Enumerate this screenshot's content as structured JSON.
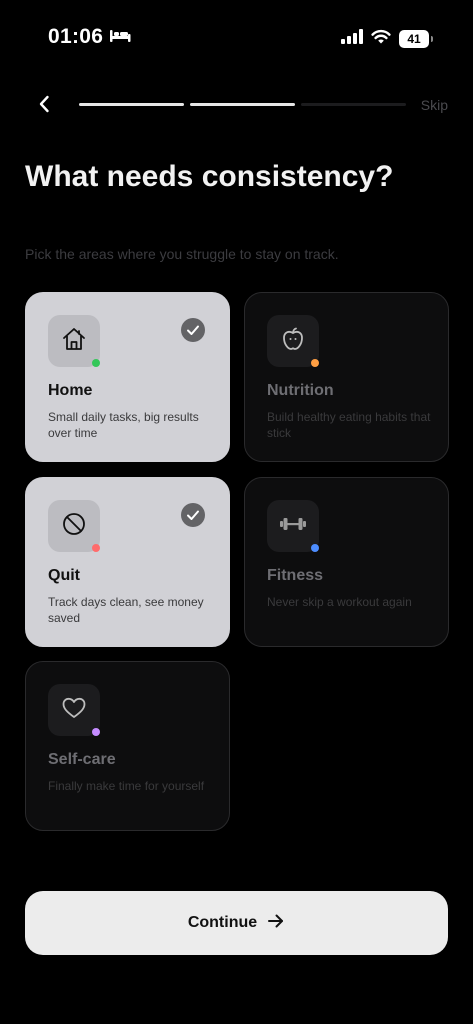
{
  "status_bar": {
    "time": "01:06",
    "battery": "41",
    "icons": [
      "bed-icon",
      "cellular-signal-icon",
      "wifi-icon",
      "battery-icon"
    ]
  },
  "nav": {
    "skip_label": "Skip",
    "progress_steps_total": 3,
    "progress_steps_completed": 2
  },
  "title": "What needs consistency?",
  "subtitle": "Pick the areas where you struggle to stay on track.",
  "categories": [
    {
      "label": "Home",
      "description": "Small daily tasks, big results over time",
      "selected": true,
      "icon": "house-icon",
      "dot_color": "#34c759"
    },
    {
      "label": "Nutrition",
      "description": "Build healthy eating habits that stick",
      "selected": false,
      "icon": "apple-icon",
      "dot_color": "#ff9f43"
    },
    {
      "label": "Quit",
      "description": "Track days clean, see money saved",
      "selected": true,
      "icon": "prohibited-icon",
      "dot_color": "#ff6b6b"
    },
    {
      "label": "Fitness",
      "description": "Never skip a workout again",
      "selected": false,
      "icon": "dumbbell-icon",
      "dot_color": "#4d8dff"
    },
    {
      "label": "Self-care",
      "description": "Finally make time for yourself",
      "selected": false,
      "icon": "heart-icon",
      "dot_color": "#c58cff"
    }
  ],
  "continue_label": "Continue",
  "colors": {
    "background": "#000000",
    "card_selected": "#d1d1d6",
    "card_unselected": "#0d0d0e",
    "button": "#ececec"
  }
}
